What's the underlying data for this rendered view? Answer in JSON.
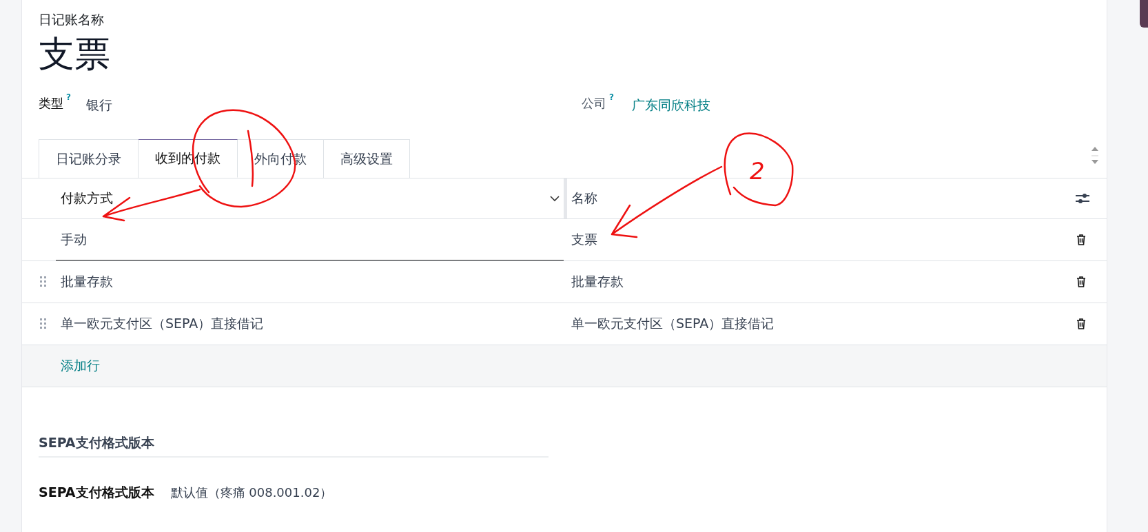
{
  "journal": {
    "name_label": "日记账名称",
    "name": "支票"
  },
  "fields": [
    {
      "label": "类型",
      "help": "?",
      "value": "银行",
      "kind": "plain"
    },
    {
      "label": "公司",
      "help": "?",
      "value": "广东同欣科技",
      "kind": "link"
    }
  ],
  "tabs": [
    {
      "label": "日记账分录",
      "selected": false
    },
    {
      "label": "收到的付款",
      "selected": true
    },
    {
      "label": "外向付款",
      "selected": false
    },
    {
      "label": "高级设置",
      "selected": false
    }
  ],
  "table": {
    "columns": [
      "付款方式",
      "名称"
    ],
    "rows": [
      {
        "cells": [
          "手动",
          "支票"
        ],
        "editing": true
      },
      {
        "cells": [
          "批量存款",
          "批量存款"
        ],
        "editing": false
      },
      {
        "cells": [
          "单一欧元支付区（SEPA）直接借记",
          "单一欧元支付区（SEPA）直接借记"
        ],
        "editing": false
      }
    ],
    "add_line": "添加行"
  },
  "sepa": {
    "heading": "SEPA支付格式版本",
    "label": "SEPA支付格式版本",
    "value": "默认值（疼痛 008.001.02）"
  },
  "annotations": [
    {
      "kind": "circle-arrow"
    },
    {
      "kind": "circle-arrow",
      "label": "2"
    }
  ]
}
